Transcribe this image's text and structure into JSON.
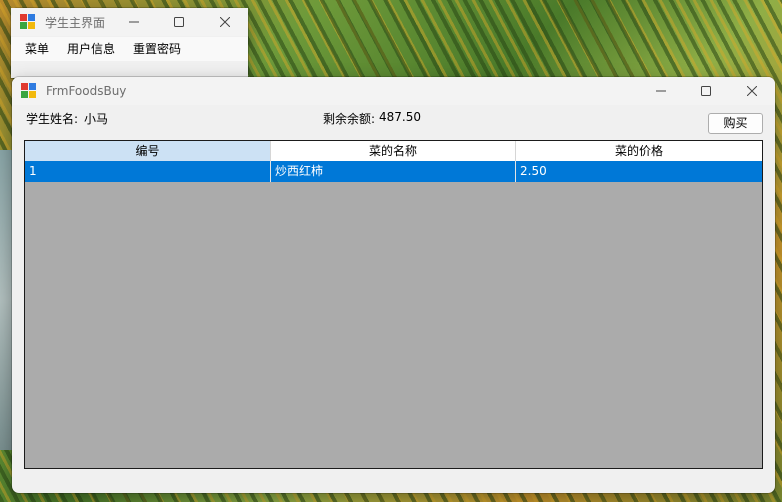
{
  "main_window": {
    "title": "学生主界面",
    "menu": [
      "菜单",
      "用户信息",
      "重置密码"
    ]
  },
  "foods_window": {
    "title": "FrmFoodsBuy",
    "student_name_label": "学生姓名:",
    "student_name": "小马",
    "balance_label": "剩余余额:",
    "balance": "487.50",
    "buy_button": "购买",
    "table": {
      "headers": [
        "编号",
        "菜的名称",
        "菜的价格"
      ],
      "rows": [
        [
          "1",
          "炒西红柿",
          "2.50"
        ]
      ]
    }
  },
  "icons": {
    "minimize": "minimize-icon",
    "maximize": "maximize-icon",
    "close": "close-icon",
    "app": "winforms-app-icon"
  }
}
